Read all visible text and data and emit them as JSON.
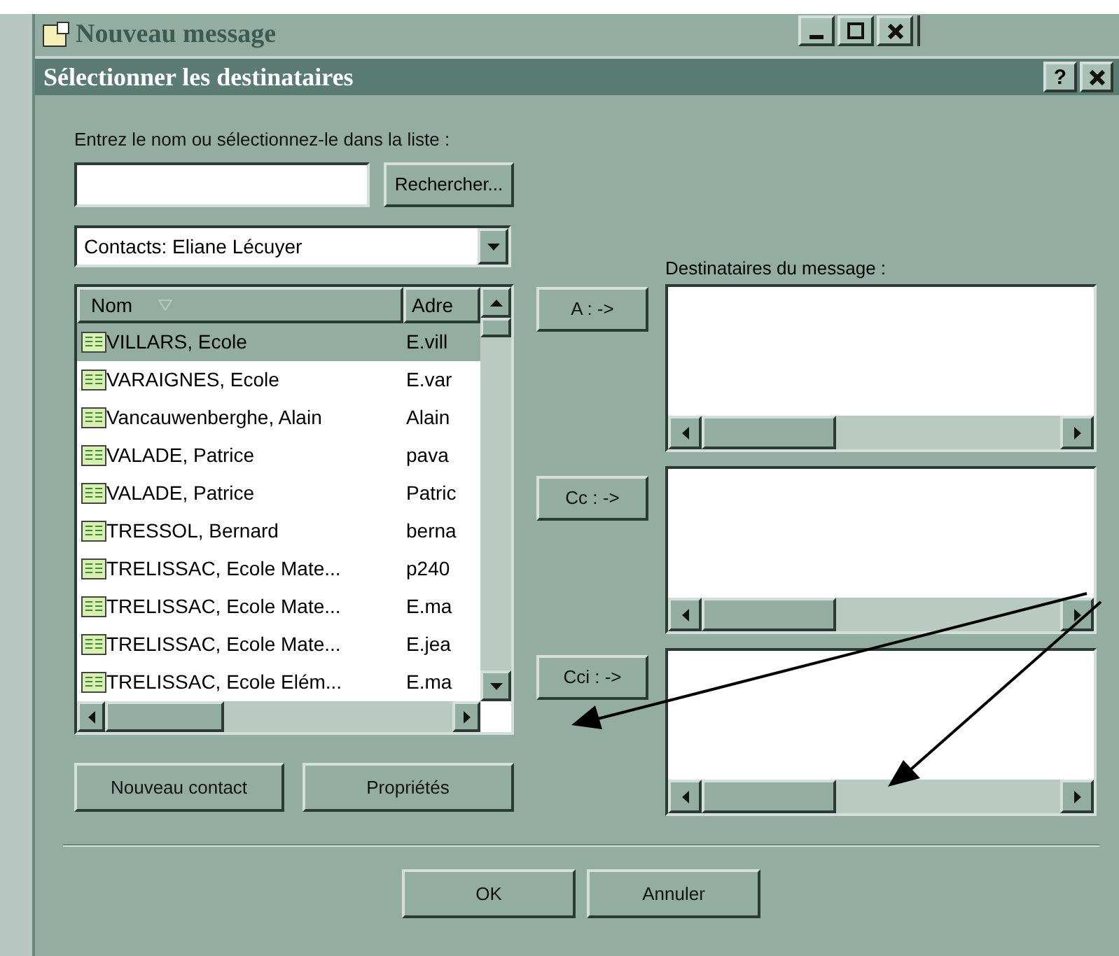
{
  "background_window": {
    "title": "Nouveau message"
  },
  "dialog": {
    "title": "Sélectionner les destinataires",
    "help_button": "?"
  },
  "search": {
    "label": "Entrez le nom ou sélectionnez-le dans la liste :",
    "button": "Rechercher..."
  },
  "address_book": "Contacts: Eliane Lécuyer",
  "contacts": {
    "columns": [
      "Nom",
      "Adre"
    ],
    "rows": [
      {
        "name": "VILLARS, Ecole",
        "address": "E.vill",
        "selected": true
      },
      {
        "name": "VARAIGNES, Ecole",
        "address": "E.var",
        "selected": false
      },
      {
        "name": "Vancauwenberghe, Alain",
        "address": "Alain",
        "selected": false
      },
      {
        "name": "VALADE, Patrice",
        "address": "pava",
        "selected": false
      },
      {
        "name": "VALADE, Patrice",
        "address": "Patric",
        "selected": false
      },
      {
        "name": "TRESSOL, Bernard",
        "address": "berna",
        "selected": false
      },
      {
        "name": "TRELISSAC, Ecole Mate...",
        "address": "p240",
        "selected": false
      },
      {
        "name": "TRELISSAC, Ecole Mate...",
        "address": "E.ma",
        "selected": false
      },
      {
        "name": "TRELISSAC, Ecole Mate...",
        "address": "E.jea",
        "selected": false
      },
      {
        "name": "TRELISSAC, Ecole Elém...",
        "address": "E.ma",
        "selected": false
      }
    ]
  },
  "add_buttons": [
    "A : ->",
    "Cc : ->",
    "Cci : ->"
  ],
  "recipients_label": "Destinataires du message :",
  "list_buttons": [
    "Nouveau contact",
    "Propriétés"
  ],
  "footer_buttons": [
    "OK",
    "Annuler"
  ]
}
